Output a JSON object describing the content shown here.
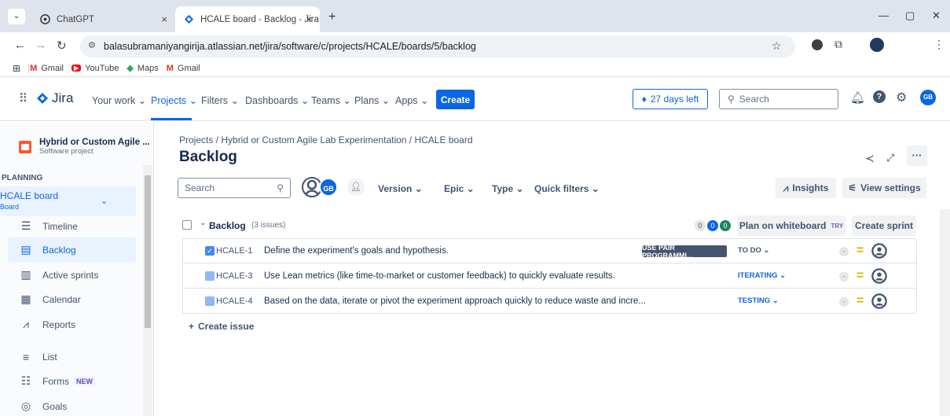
{
  "browser": {
    "tabs": [
      {
        "title": "ChatGPT",
        "close": "×"
      },
      {
        "title": "HCALE board - Backlog - Jira",
        "close": "×"
      }
    ],
    "new_tab": "+",
    "url": "balasubramaniyangirija.atlassian.net/jira/software/c/projects/HCALE/boards/5/backlog",
    "bookmarks": [
      "Gmail",
      "YouTube",
      "Maps",
      "Gmail"
    ]
  },
  "jira": {
    "logo": "Jira",
    "nav": [
      "Your work",
      "Projects",
      "Filters",
      "Dashboards",
      "Teams",
      "Plans",
      "Apps"
    ],
    "create": "Create",
    "trial": "27 days left",
    "search_placeholder": "Search",
    "avatar": "GB"
  },
  "sidebar": {
    "project_name": "Hybrid or Custom Agile ...",
    "project_type": "Software project",
    "section": "PLANNING",
    "board_name": "HCALE board",
    "board_sub": "Board",
    "items": [
      {
        "label": "Timeline",
        "icon": "timeline-icon"
      },
      {
        "label": "Backlog",
        "icon": "backlog-icon"
      },
      {
        "label": "Active sprints",
        "icon": "sprints-icon"
      },
      {
        "label": "Calendar",
        "icon": "calendar-icon"
      },
      {
        "label": "Reports",
        "icon": "reports-icon"
      },
      {
        "label": "List",
        "icon": "list-icon"
      },
      {
        "label": "Forms",
        "icon": "forms-icon",
        "badge": "NEW"
      },
      {
        "label": "Goals",
        "icon": "goals-icon"
      }
    ]
  },
  "main": {
    "breadcrumb": "Projects  /  Hybrid or Custom Agile Lab Experimentation  /  HCALE board",
    "title": "Backlog",
    "search_placeholder": "Search",
    "avatar": "GB",
    "filters": [
      "Version",
      "Epic",
      "Type",
      "Quick filters"
    ],
    "insights": "Insights",
    "view_settings": "View settings",
    "backlog_label": "Backlog",
    "issue_count": "(3 issues)",
    "counts": [
      "0",
      "0",
      "0"
    ],
    "plan_whiteboard": "Plan on whiteboard",
    "try_badge": "TRY",
    "create_sprint": "Create sprint",
    "issues": [
      {
        "key": "HCALE-1",
        "summary": "Define the experiment's goals and hypothesis.",
        "epic": "USE PAIR PROGRAMMI...",
        "status": "TO DO",
        "status_color": "#44546f",
        "type": "task"
      },
      {
        "key": "HCALE-3",
        "summary": "Use Lean metrics (like time-to-market or customer feedback) to quickly evaluate results.",
        "epic": "",
        "status": "ITERATING",
        "status_color": "#0c66e4",
        "type": "subtask"
      },
      {
        "key": "HCALE-4",
        "summary": "Based on the data, iterate or pivot the experiment approach quickly to reduce waste and incre...",
        "epic": "",
        "status": "TESTING",
        "status_color": "#0c66e4",
        "type": "subtask"
      }
    ],
    "estimate": "-",
    "create_issue": "Create issue"
  }
}
